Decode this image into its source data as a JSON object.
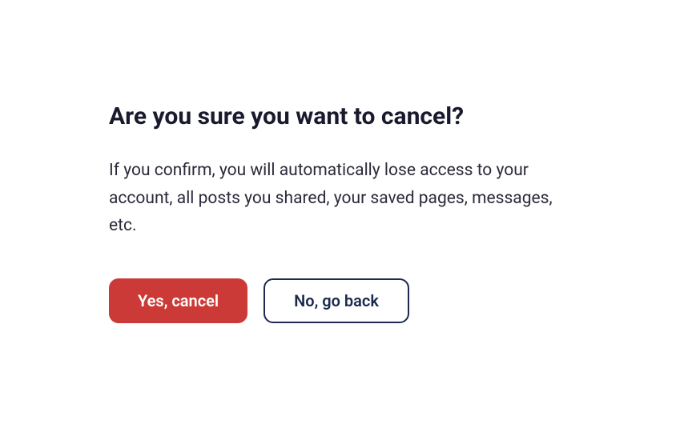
{
  "dialog": {
    "title": "Are you sure you want to cancel?",
    "body": "If you confirm, you will automatically lose access to your account, all posts you shared, your saved pages, messages, etc.",
    "confirm_label": "Yes, cancel",
    "cancel_label": "No, go back"
  },
  "colors": {
    "danger": "#CB3A36",
    "text_dark": "#1b2a4e"
  }
}
